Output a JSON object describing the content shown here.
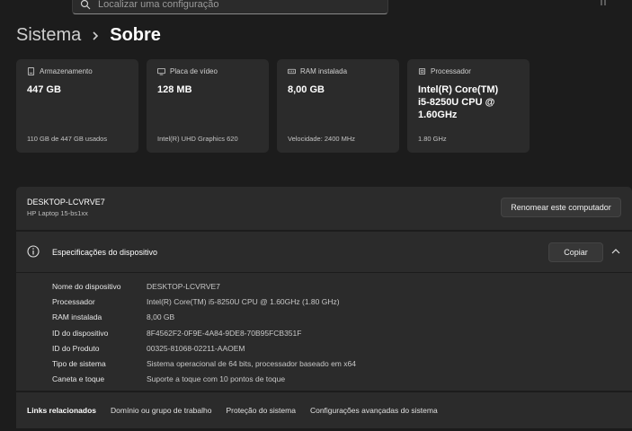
{
  "search": {
    "placeholder": "Localizar uma configuração"
  },
  "breadcrumb": {
    "parent": "Sistema",
    "current": "Sobre"
  },
  "cards": [
    {
      "icon": "storage-icon",
      "label": "Armazenamento",
      "value": "447 GB",
      "sub": "110 GB de 447 GB usados"
    },
    {
      "icon": "gpu-icon",
      "label": "Placa de vídeo",
      "value": "128 MB",
      "sub": "Intel(R) UHD Graphics 620"
    },
    {
      "icon": "ram-icon",
      "label": "RAM instalada",
      "value": "8,00 GB",
      "sub": "Velocidade: 2400 MHz"
    },
    {
      "icon": "cpu-icon",
      "label": "Processador",
      "value": "Intel(R) Core(TM) i5-8250U CPU @ 1.60GHz",
      "sub": "1.80 GHz"
    }
  ],
  "device": {
    "name": "DESKTOP-LCVRVE7",
    "model": "HP Laptop 15-bs1xx",
    "rename_label": "Renomear este computador"
  },
  "specs": {
    "title": "Especificações do dispositivo",
    "copy_label": "Copiar",
    "rows": [
      {
        "label": "Nome do dispositivo",
        "value": "DESKTOP-LCVRVE7"
      },
      {
        "label": "Processador",
        "value": "Intel(R) Core(TM) i5-8250U CPU @ 1.60GHz (1.80 GHz)"
      },
      {
        "label": "RAM instalada",
        "value": "8,00 GB"
      },
      {
        "label": "ID do dispositivo",
        "value": "8F4562F2-0F9E-4A84-9DE8-70B95FCB351F"
      },
      {
        "label": "ID do Produto",
        "value": "00325-81068-02211-AAOEM"
      },
      {
        "label": "Tipo de sistema",
        "value": "Sistema operacional de 64 bits, processador baseado em x64"
      },
      {
        "label": "Caneta e toque",
        "value": "Suporte a toque com 10 pontos de toque"
      }
    ]
  },
  "related": {
    "heading": "Links relacionados",
    "links": [
      "Domínio ou grupo de trabalho",
      "Proteção do sistema",
      "Configurações avançadas do sistema"
    ]
  }
}
